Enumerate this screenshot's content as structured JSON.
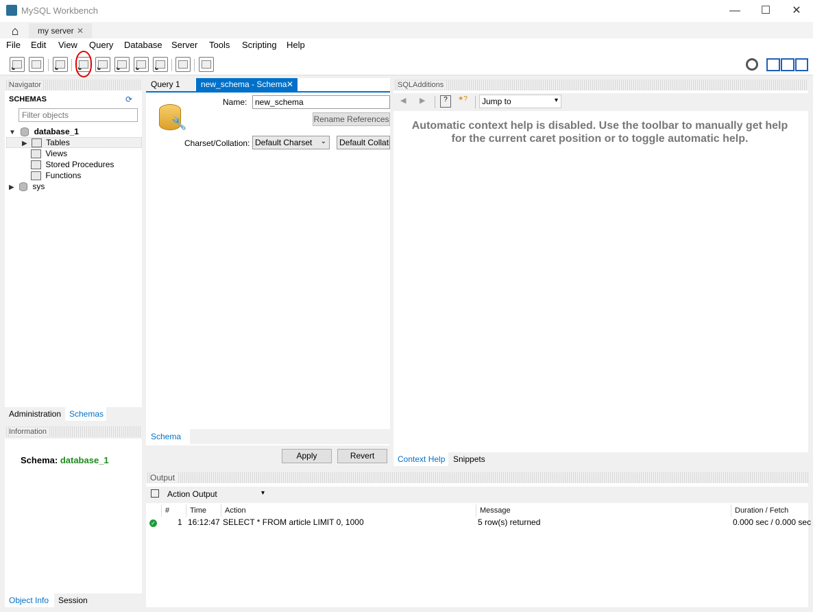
{
  "window": {
    "title": "MySQL Workbench",
    "minimize": "—",
    "maximize": "☐",
    "close": "✕"
  },
  "tabs": {
    "connection": "my server",
    "close": "✕"
  },
  "menu": [
    "File",
    "Edit",
    "View",
    "Query",
    "Database",
    "Server",
    "Tools",
    "Scripting",
    "Help"
  ],
  "navigator": {
    "title": "Navigator",
    "schemas_label": "SCHEMAS",
    "filter_placeholder": "Filter objects",
    "tree": {
      "db1": "database_1",
      "tables": "Tables",
      "views": "Views",
      "procedures": "Stored Procedures",
      "functions": "Functions",
      "sys": "sys"
    },
    "bottom_tabs": [
      "Administration",
      "Schemas"
    ]
  },
  "information": {
    "title": "Information",
    "schema_label": "Schema:",
    "schema_value": "database_1",
    "tabs": [
      "Object Info",
      "Session"
    ]
  },
  "editor": {
    "tab_query": "Query 1",
    "tab_schema": "new_schema - Schema",
    "tab_close": "✕",
    "name_label": "Name:",
    "name_value": "new_schema",
    "rename_button": "Rename References",
    "charset_label": "Charset/Collation:",
    "charset_value": "Default Charset",
    "collation_value": "Default Collation",
    "subtab": "Schema",
    "apply": "Apply",
    "revert": "Revert"
  },
  "sql_additions": {
    "title": "SQLAdditions",
    "jump_to": "Jump to",
    "help_text": "Automatic context help is disabled. Use the toolbar to manually get help for the current caret position or to toggle automatic help.",
    "tabs": [
      "Context Help",
      "Snippets"
    ]
  },
  "output": {
    "title": "Output",
    "selector": "Action Output",
    "columns": [
      "#",
      "Time",
      "Action",
      "Message",
      "Duration / Fetch"
    ],
    "rows": [
      {
        "num": "1",
        "time": "16:12:47",
        "action": "SELECT * FROM article LIMIT 0, 1000",
        "message": "5 row(s) returned",
        "duration": "0.000 sec / 0.000 sec"
      }
    ]
  },
  "colors": {
    "accent": "#0070c9",
    "schema_green": "#1e8a1e",
    "annotation_red": "#e10000"
  }
}
